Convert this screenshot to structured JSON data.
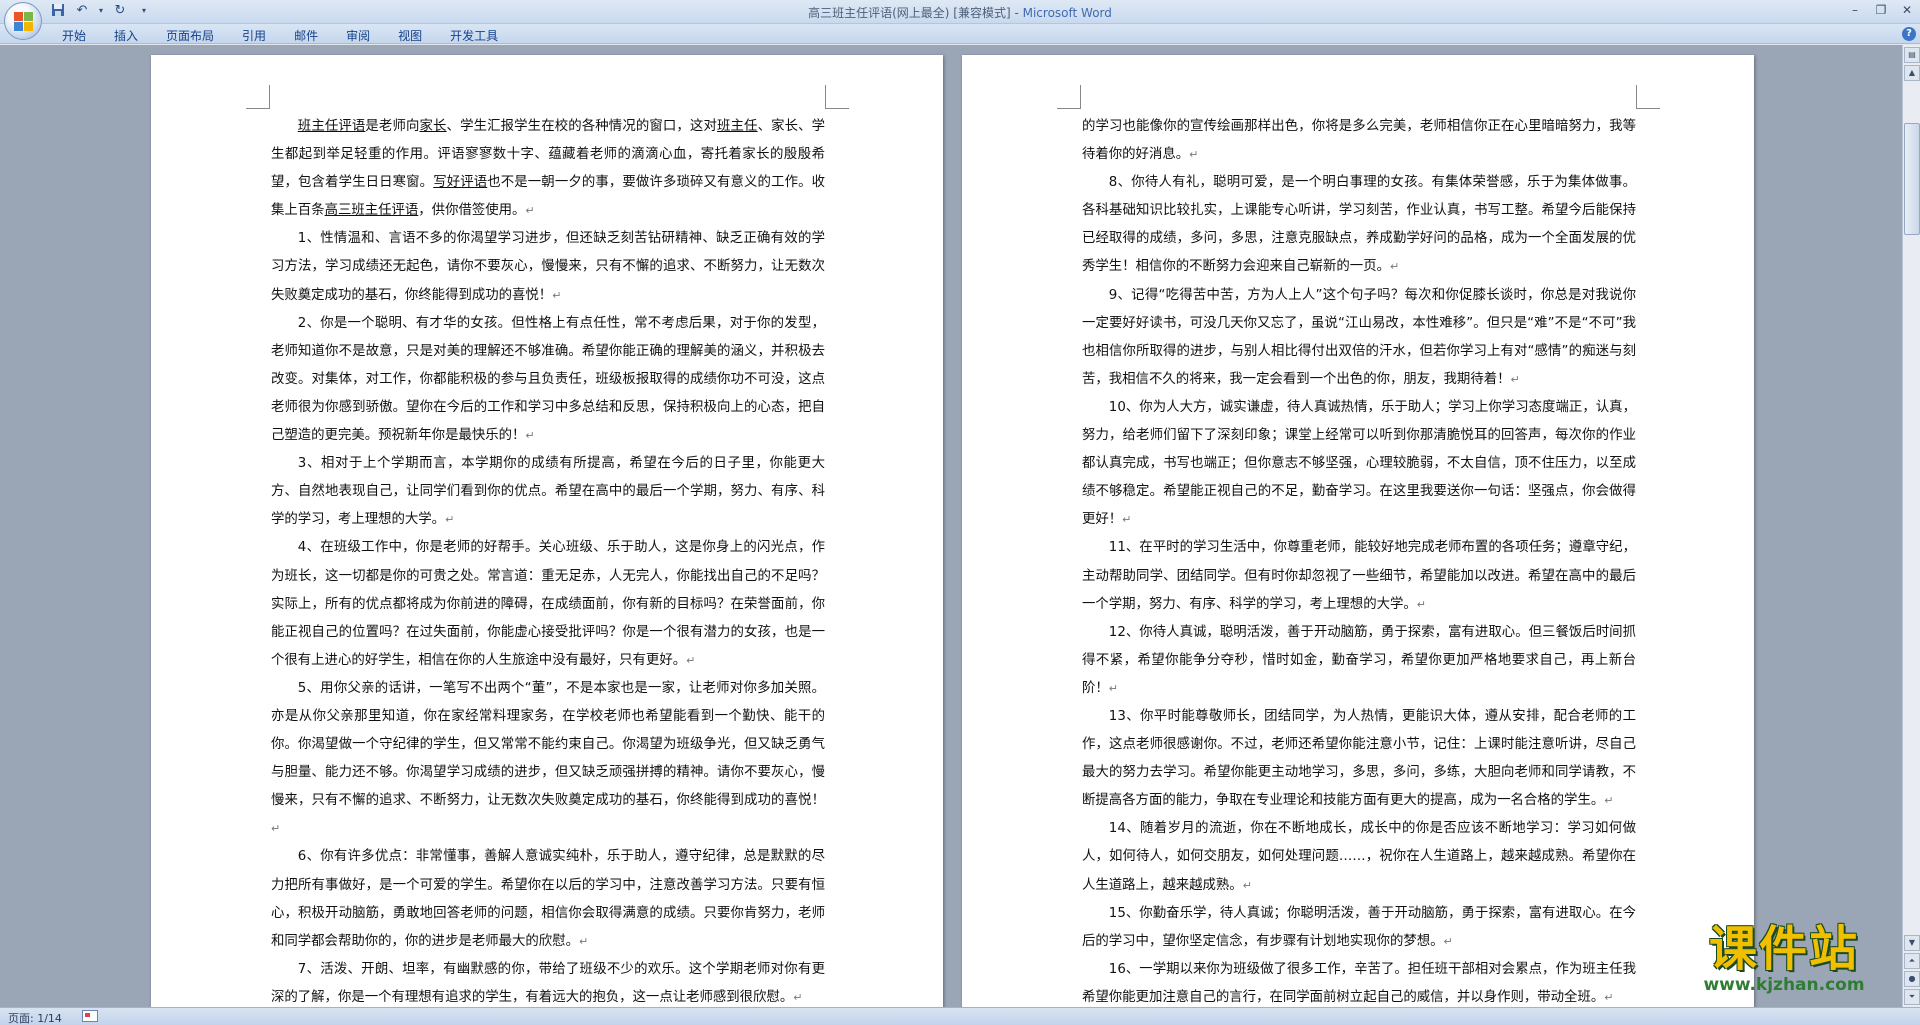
{
  "window": {
    "title": "高三班主任评语(网上最全) [兼容模式]",
    "title_sep": " - ",
    "app_name": "Microsoft Word"
  },
  "ribbon": {
    "tabs": [
      "开始",
      "插入",
      "页面布局",
      "引用",
      "邮件",
      "审阅",
      "视图",
      "开发工具"
    ]
  },
  "status": {
    "page_label": "页面: 1/14"
  },
  "watermark": {
    "text": "课件站",
    "url": "www.kjzhan.com"
  },
  "left_page": [
    {
      "cont": false,
      "html": "<span class=\"u\">班主任评语</span>是老师向<span class=\"u\">家长</span>、学生汇报学生在校的各种情况的窗口，这对<span class=\"u\">班主任</span>、家长、学生都起到举足轻重的作用。评语寥寥数十字、蕴藏着老师的滴滴心血，寄托着家长的殷殷希望，包含着学生日日寒窗。<span class=\"u\">写好评语</span>也不是一朝一夕的事，要做许多琐碎又有意义的工作。收集上百条<span class=\"u\">高三班主任评语</span>，供你借签使用。"
    },
    {
      "cont": false,
      "html": "1、性情温和、言语不多的你渴望学习进步，但还缺乏刻苦钻研精神、缺乏正确有效的学习方法，学习成绩还无起色，请你不要灰心，慢慢来，只有不懈的追求、不断努力，让无数次失败奠定成功的基石，你终能得到成功的喜悦！"
    },
    {
      "cont": false,
      "html": "2、你是一个聪明、有才华的女孩。但性格上有点任性，常不考虑后果，对于你的发型，老师知道你不是故意，只是对美的理解还不够准确。希望你能正确的理解美的涵义，并积极去改变。对集体，对工作，你都能积极的参与且负责任，班级板报取得的成绩你功不可没，这点老师很为你感到骄傲。望你在今后的工作和学习中多总结和反思，保持积极向上的心态，把自己塑造的更完美。预祝新年你是最快乐的！"
    },
    {
      "cont": false,
      "html": "3、相对于上个学期而言，本学期你的成绩有所提高，希望在今后的日子里，你能更大方、自然地表现自己，让同学们看到你的优点。希望在高中的最后一个学期，努力、有序、科学的学习，考上理想的大学。"
    },
    {
      "cont": false,
      "html": "4、在班级工作中，你是老师的好帮手。关心班级、乐于助人，这是你身上的闪光点，作为班长，这一切都是你的可贵之处。常言道：重无足赤，人无完人，你能找出自己的不足吗？实际上，所有的优点都将成为你前进的障碍，在成绩面前，你有新的目标吗？在荣誉面前，你能正视自己的位置吗？在过失面前，你能虚心接受批评吗？你是一个很有潜力的女孩，也是一个很有上进心的好学生，相信在你的人生旅途中没有最好，只有更好。"
    },
    {
      "cont": false,
      "html": "5、用你父亲的话讲，一笔写不出两个“董”，不是本家也是一家，让老师对你多加关照。亦是从你父亲那里知道，你在家经常料理家务，在学校老师也希望能看到一个勤快、能干的你。你渴望做一个守纪律的学生，但又常常不能约束自己。你渴望为班级争光，但又缺乏勇气与胆量、能力还不够。你渴望学习成绩的进步，但又缺乏顽强拼搏的精神。请你不要灰心，慢慢来，只有不懈的追求、不断努力，让无数次失败奠定成功的基石，你终能得到成功的喜悦！"
    },
    {
      "cont": false,
      "html": "6、你有许多优点：非常懂事，善解人意诚实纯朴，乐于助人，遵守纪律，总是默默的尽力把所有事做好，是一个可爱的学生。希望你在以后的学习中，注意改善学习方法。只要有恒心，积极开动脑筋，勇敢地回答老师的问题，相信你会取得满意的成绩。只要你肯努力，老师和同学都会帮助你的，你的进步是老师最大的欣慰。"
    },
    {
      "cont": false,
      "html": "7、活泼、开朗、坦率，有幽默感的你，带给了班级不少的欢乐。这个学期老师对你有更深的了解，你是一个有理想有追求的学生，有着远大的抱负，这一点让老师感到很欣慰。"
    }
  ],
  "right_page": [
    {
      "cont": true,
      "html": "的学习也能像你的宣传绘画那样出色，你将是多么完美，老师相信你正在心里暗暗努力，我等待着你的好消息。"
    },
    {
      "cont": false,
      "html": "8、你待人有礼，聪明可爱，是一个明白事理的女孩。有集体荣誉感，乐于为集体做事。各科基础知识比较扎实，上课能专心听讲，学习刻苦，作业认真，书写工整。希望今后能保持已经取得的成绩，多问，多思，注意克服缺点，养成勤学好问的品格，成为一个全面发展的优秀学生！相信你的不断努力会迎来自己崭新的一页。"
    },
    {
      "cont": false,
      "html": "9、记得“吃得苦中苦，方为人上人”这个句子吗？每次和你促膝长谈时，你总是对我说你一定要好好读书，可没几天你又忘了，虽说“江山易改，本性难移”。但只是“难”不是“不可”我也相信你所取得的进步，与别人相比得付出双倍的汗水，但若你学习上有对“感情”的痴迷与刻苦，我相信不久的将来，我一定会看到一个出色的你，朋友，我期待着！"
    },
    {
      "cont": false,
      "html": "10、你为人大方，诚实谦虚，待人真诚热情，乐于助人；学习上你学习态度端正，认真，努力，给老师们留下了深刻印象；课堂上经常可以听到你那清脆悦耳的回答声，每次你的作业都认真完成，书写也端正；但你意志不够坚强，心理较脆弱，不太自信，顶不住压力，以至成绩不够稳定。希望能正视自己的不足，勤奋学习。在这里我要送你一句话：坚强点，你会做得更好！"
    },
    {
      "cont": false,
      "html": "11、在平时的学习生活中，你尊重老师，能较好地完成老师布置的各项任务；遵章守纪，主动帮助同学、团结同学。但有时你却忽视了一些细节，希望能加以改进。希望在高中的最后一个学期，努力、有序、科学的学习，考上理想的大学。"
    },
    {
      "cont": false,
      "html": "12、你待人真诚，聪明活泼，善于开动脑筋，勇于探索，富有进取心。但三餐饭后时间抓得不紧，希望你能争分夺秒，惜时如金，勤奋学习，希望你更加严格地要求自己，再上新台阶！"
    },
    {
      "cont": false,
      "html": "13、你平时能尊敬师长，团结同学，为人热情，更能识大体，遵从安排，配合老师的工作，这点老师很感谢你。不过，老师还希望你能注意小节，记住：上课时能注意听讲，尽自己最大的努力去学习。希望你能更主动地学习，多思，多问，多练，大胆向老师和同学请教，不断提高各方面的能力，争取在专业理论和技能方面有更大的提高，成为一名合格的学生。"
    },
    {
      "cont": false,
      "html": "14、随着岁月的流逝，你在不断地成长，成长中的你是否应该不断地学习：学习如何做人，如何待人，如何交朋友，如何处理问题……，祝你在人生道路上，越来越成熟。希望你在人生道路上，越来越成熟。"
    },
    {
      "cont": false,
      "html": "15、你勤奋乐学，待人真诚；你聪明活泼，善于开动脑筋，勇于探索，富有进取心。在今后的学习中，望你坚定信念，有步骤有计划地实现你的梦想。"
    },
    {
      "cont": false,
      "html": "16、一学期以来你为班级做了很多工作，辛苦了。担任班干部相对会累点，作为班主任我希望你能更加注意自己的言行，在同学面前树立起自己的威信，并以身作则，带动全班。"
    }
  ]
}
